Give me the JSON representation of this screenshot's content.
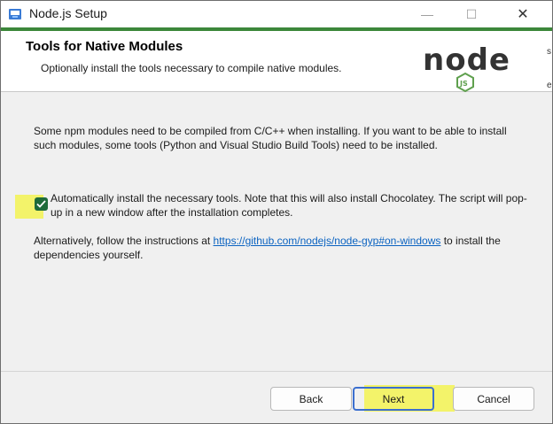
{
  "window": {
    "title": "Node.js Setup",
    "minimize": "—",
    "maximize": "☐",
    "close": "✕"
  },
  "header": {
    "title": "Tools for Native Modules",
    "subtitle": "Optionally install the tools necessary to compile native modules.",
    "logo_text": "node",
    "logo_badge": "JS",
    "edge_mark_1": "s",
    "edge_mark_2": "e"
  },
  "content": {
    "intro": "Some npm modules need to be compiled from C/C++ when installing. If you want to be able to install such modules, some tools (Python and Visual Studio Build Tools) need to be installed.",
    "checkbox": {
      "checked": true,
      "label": "Automatically install the necessary tools. Note that this will also install Chocolatey. The script will pop-up in a new window after the installation completes."
    },
    "alt_prefix": "Alternatively, follow the instructions at ",
    "alt_link": "https://github.com/nodejs/node-gyp#on-windows",
    "alt_suffix": " to install the dependencies yourself."
  },
  "footer": {
    "back_label": "Back",
    "next_label": "Next",
    "cancel_label": "Cancel"
  },
  "colors": {
    "accent_green": "#3c873a",
    "link_blue": "#0b63c1",
    "highlight_yellow": "#f3f36a",
    "focus_blue": "#3b6fcf"
  }
}
